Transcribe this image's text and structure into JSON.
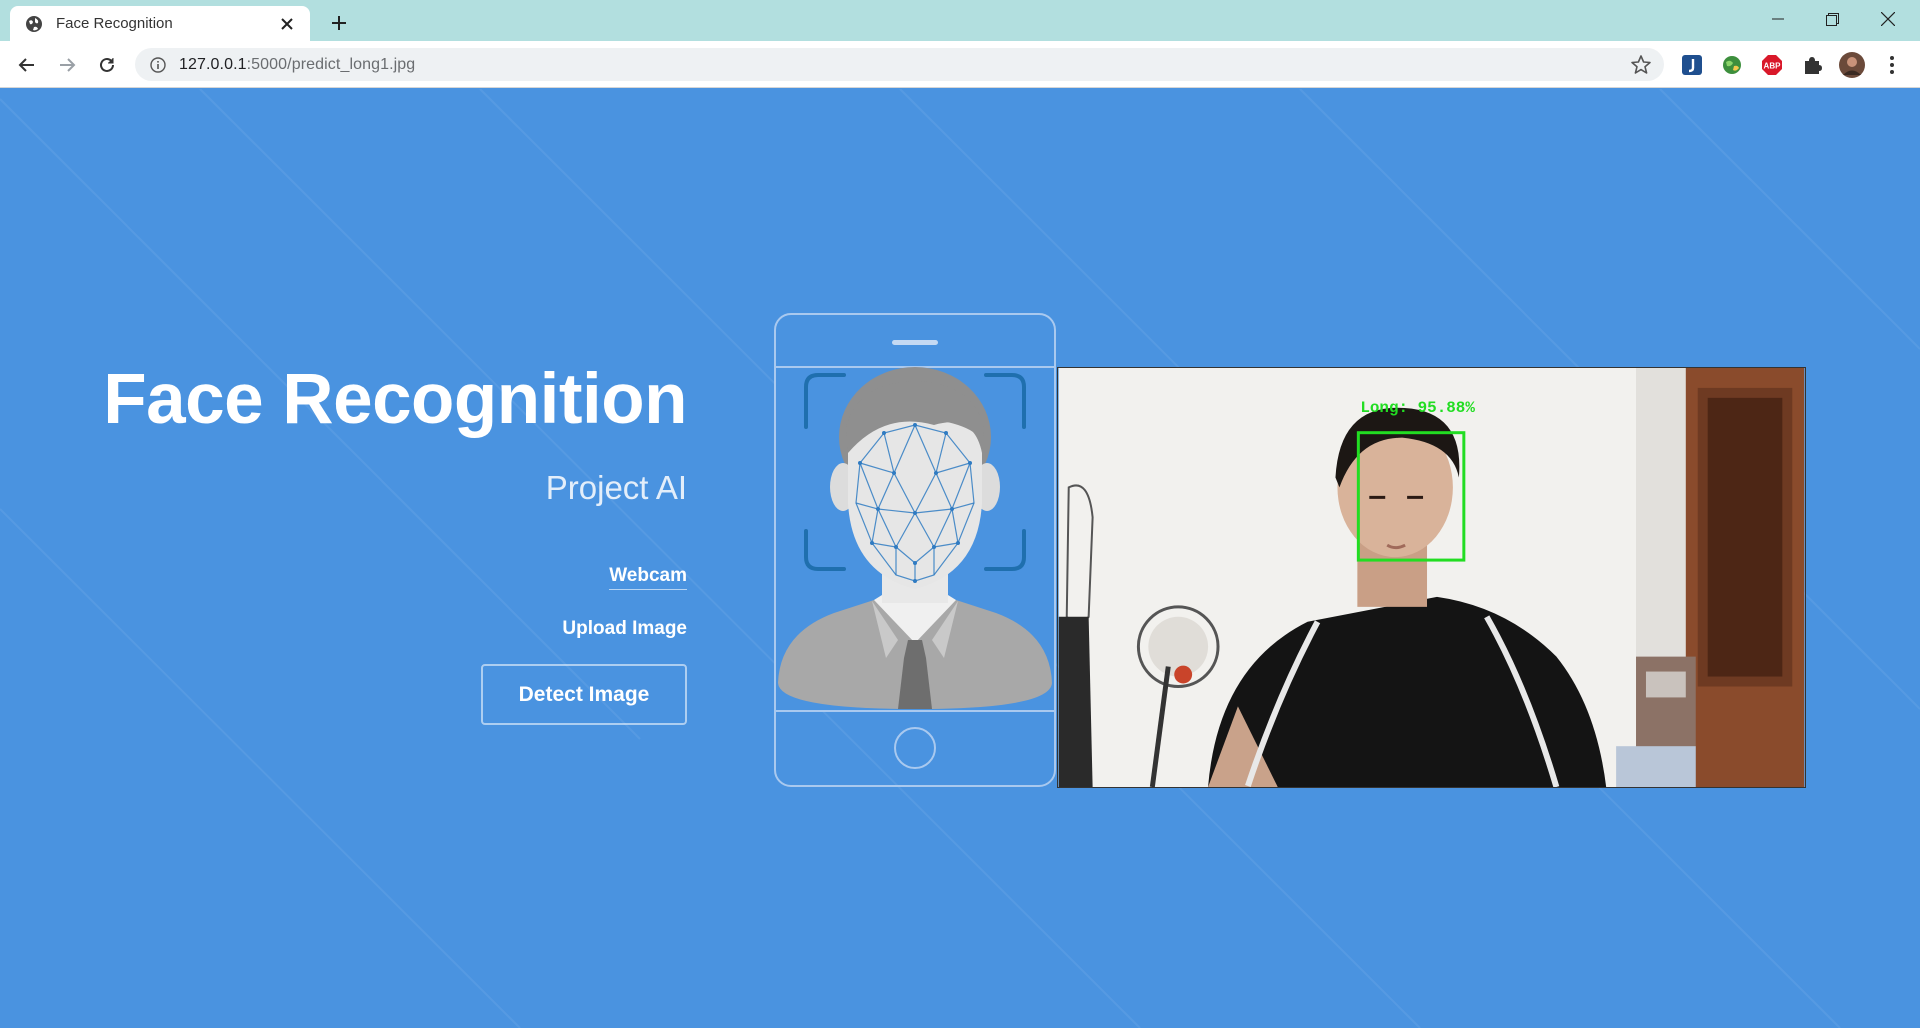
{
  "browser": {
    "tab_title": "Face Recognition",
    "url_host": "127.0.0.1",
    "url_path": ":5000/predict_long1.jpg"
  },
  "extensions": [
    "j-icon",
    "globe-extension-icon",
    "adblock-plus-icon",
    "puzzle-icon",
    "profile-avatar",
    "kebab-menu-icon"
  ],
  "hero": {
    "title": "Face Recognition",
    "subtitle": "Project AI"
  },
  "nav": {
    "webcam": "Webcam",
    "upload": "Upload Image",
    "detect": "Detect Image"
  },
  "result": {
    "label": "Long: 95.88%",
    "box_color": "#22dd22"
  },
  "colors": {
    "page_bg": "#4a93e0",
    "tabstrip_bg": "#b2dfdf",
    "accent_mesh": "#3a84c8"
  }
}
